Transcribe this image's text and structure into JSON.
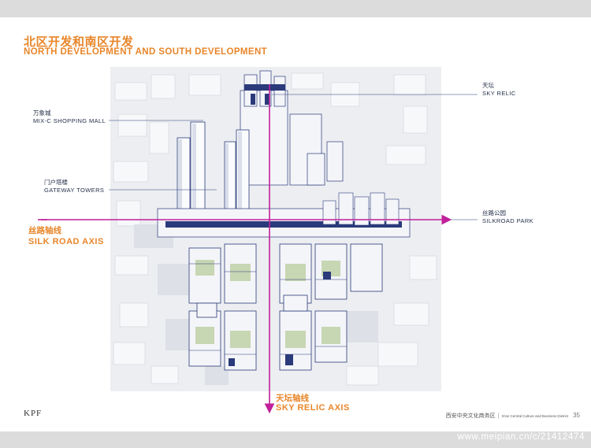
{
  "header": {
    "title_cn": "北区开发和南区开发",
    "title_en": "NORTH DEVELOPMENT AND SOUTH DEVELOPMENT"
  },
  "labels": {
    "sky_relic": {
      "cn": "天坛",
      "en": "SKY RELIC"
    },
    "mixc": {
      "cn": "万象城",
      "en": "MIX-C SHOPPING MALL"
    },
    "gateway": {
      "cn": "门户塔楼",
      "en": "GATEWAY TOWERS"
    },
    "silkroad_park": {
      "cn": "丝路公园",
      "en": "SILKROAD PARK"
    }
  },
  "axes": {
    "silk_road": {
      "cn": "丝路轴线",
      "en": "SILK ROAD AXIS"
    },
    "sky_relic": {
      "cn": "天坛轴线",
      "en": "SKY RELIC AXIS"
    }
  },
  "colors": {
    "accent_orange": "#e8862a",
    "axis_magenta": "#c0209a",
    "building_navy": "#2a3a7a",
    "park_green": "#c7d6b3"
  },
  "footer": {
    "logo": "KPF",
    "cn": "西安中央文化商务区",
    "en": "Xi'an Central Culture and Business District",
    "page": "35"
  },
  "watermark": "www.meipian.cn/c/21412474"
}
